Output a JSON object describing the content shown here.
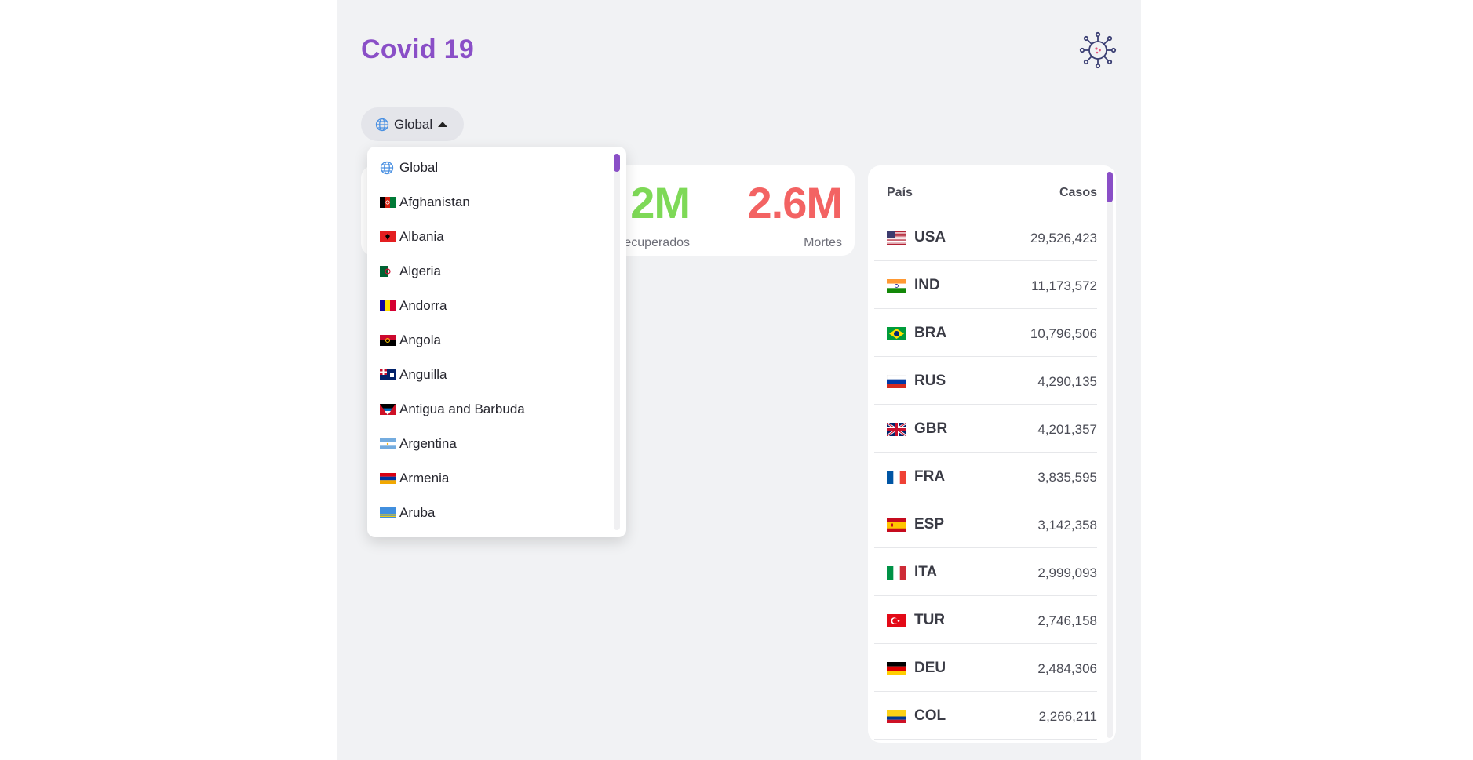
{
  "app": {
    "title": "Covid 19",
    "icon": "virus-icon",
    "accent": "#8a4fc7"
  },
  "selector": {
    "label": "Global",
    "icon": "globe-icon",
    "caret": "caret-up-icon"
  },
  "stats": {
    "recovered": {
      "value": "2M",
      "label": "ecuperados",
      "color": "#7ed957"
    },
    "deaths": {
      "value": "2.6M",
      "label": "Mortes",
      "color": "#f36363"
    }
  },
  "dropdown": {
    "items": [
      {
        "label": "Global",
        "flag": "globe"
      },
      {
        "label": "Afghanistan",
        "flag": "AFG"
      },
      {
        "label": "Albania",
        "flag": "ALB"
      },
      {
        "label": "Algeria",
        "flag": "DZA"
      },
      {
        "label": "Andorra",
        "flag": "AND"
      },
      {
        "label": "Angola",
        "flag": "AGO"
      },
      {
        "label": "Anguilla",
        "flag": "AIA"
      },
      {
        "label": "Antigua and Barbuda",
        "flag": "ATG"
      },
      {
        "label": "Argentina",
        "flag": "ARG"
      },
      {
        "label": "Armenia",
        "flag": "ARM"
      },
      {
        "label": "Aruba",
        "flag": "ABW"
      }
    ]
  },
  "table": {
    "headers": {
      "country": "País",
      "cases": "Casos"
    },
    "rows": [
      {
        "code": "USA",
        "cases": "29,526,423"
      },
      {
        "code": "IND",
        "cases": "11,173,572"
      },
      {
        "code": "BRA",
        "cases": "10,796,506"
      },
      {
        "code": "RUS",
        "cases": "4,290,135"
      },
      {
        "code": "GBR",
        "cases": "4,201,357"
      },
      {
        "code": "FRA",
        "cases": "3,835,595"
      },
      {
        "code": "ESP",
        "cases": "3,142,358"
      },
      {
        "code": "ITA",
        "cases": "2,999,093"
      },
      {
        "code": "TUR",
        "cases": "2,746,158"
      },
      {
        "code": "DEU",
        "cases": "2,484,306"
      },
      {
        "code": "COL",
        "cases": "2,266,211"
      }
    ]
  }
}
